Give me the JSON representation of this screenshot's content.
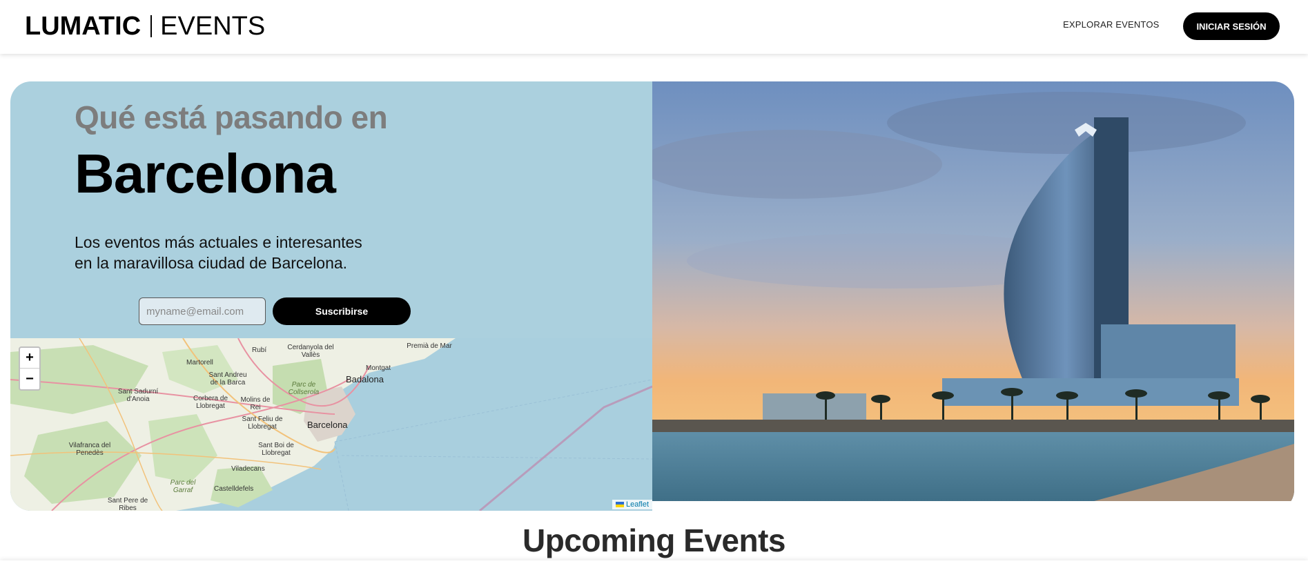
{
  "header": {
    "brand": "LUMATIC",
    "brand_sub": "EVENTS",
    "nav_explore": "EXPLORAR EVENTOS",
    "login": "INICIAR SESIÓN"
  },
  "hero": {
    "kicker": "Qué está pasando en",
    "city": "Barcelona",
    "description_line1": "Los eventos más actuales e interesantes",
    "description_line2": "en la maravillosa ciudad de Barcelona.",
    "email_placeholder": "myname@email.com",
    "subscribe_label": "Suscribirse"
  },
  "map": {
    "zoom_in": "+",
    "zoom_out": "−",
    "attribution": "Leaflet",
    "labels": [
      "Premià de Mar",
      "Cerdanyola del Vallès",
      "Martorell",
      "Rubí",
      "Montgat",
      "Badalona",
      "Sant Andreu de la Barca",
      "Parc de Collserola",
      "Sant Sadurní d'Anoia",
      "Corbera de Llobregat",
      "Molins de Rei",
      "Barcelona",
      "Sant Feliu de Llobregat",
      "Vilafranca del Penedès",
      "Sant Boi de Llobregat",
      "Viladecans",
      "Parc del Garraf",
      "Castelldefels",
      "Sant Pere de Ribes"
    ]
  },
  "upcoming": {
    "title": "Upcoming Events"
  },
  "colors": {
    "hero_panel": "#abd0de",
    "accent_button": "#000000",
    "kicker_text": "#7d7d7d"
  }
}
